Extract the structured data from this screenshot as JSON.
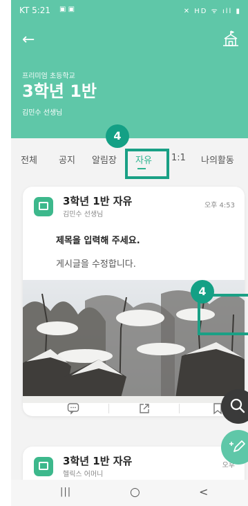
{
  "statusbar": {
    "time": "KT 5:21",
    "left_icons": "▣ ▣",
    "right_icons": "✕ HD ᯤ ıll ▮"
  },
  "header": {
    "back_icon": "←",
    "school_icon": "school-icon",
    "school_name": "프리미엄 초등학교",
    "class_title": "3학년 1반",
    "teacher_name": "김민수 선생님"
  },
  "tabs": [
    {
      "label": "전체",
      "active": false
    },
    {
      "label": "공지",
      "active": false
    },
    {
      "label": "알림장",
      "active": false
    },
    {
      "label": "자유",
      "active": true
    },
    {
      "label": "1:1",
      "active": false
    },
    {
      "label": "나의활동",
      "active": false
    }
  ],
  "annotations": {
    "step_tab": "4",
    "step_photo": "4",
    "highlight_color": "#1aa085"
  },
  "posts": [
    {
      "title": "3학년 1반 자유",
      "author": "김민수 선생님",
      "time": "오후 4:53",
      "subject": "제목을 입력해 주세요.",
      "body": "게시글을 수정합니다."
    },
    {
      "title": "3학년 1반 자유",
      "author": "헬릭스 어머니",
      "time": "오후"
    }
  ],
  "actions": {
    "comment_icon": "comment-icon",
    "share_icon": "share-icon",
    "bookmark_icon": "bookmark-icon"
  },
  "fabs": {
    "search_icon": "search-icon",
    "write_icon": "write-icon"
  },
  "navbar": {
    "recent": "|||",
    "home": "○",
    "back": "<"
  },
  "colors": {
    "header": "#5fc7a8",
    "accent": "#2bb38f",
    "fab_dark": "#3a3a3a"
  }
}
